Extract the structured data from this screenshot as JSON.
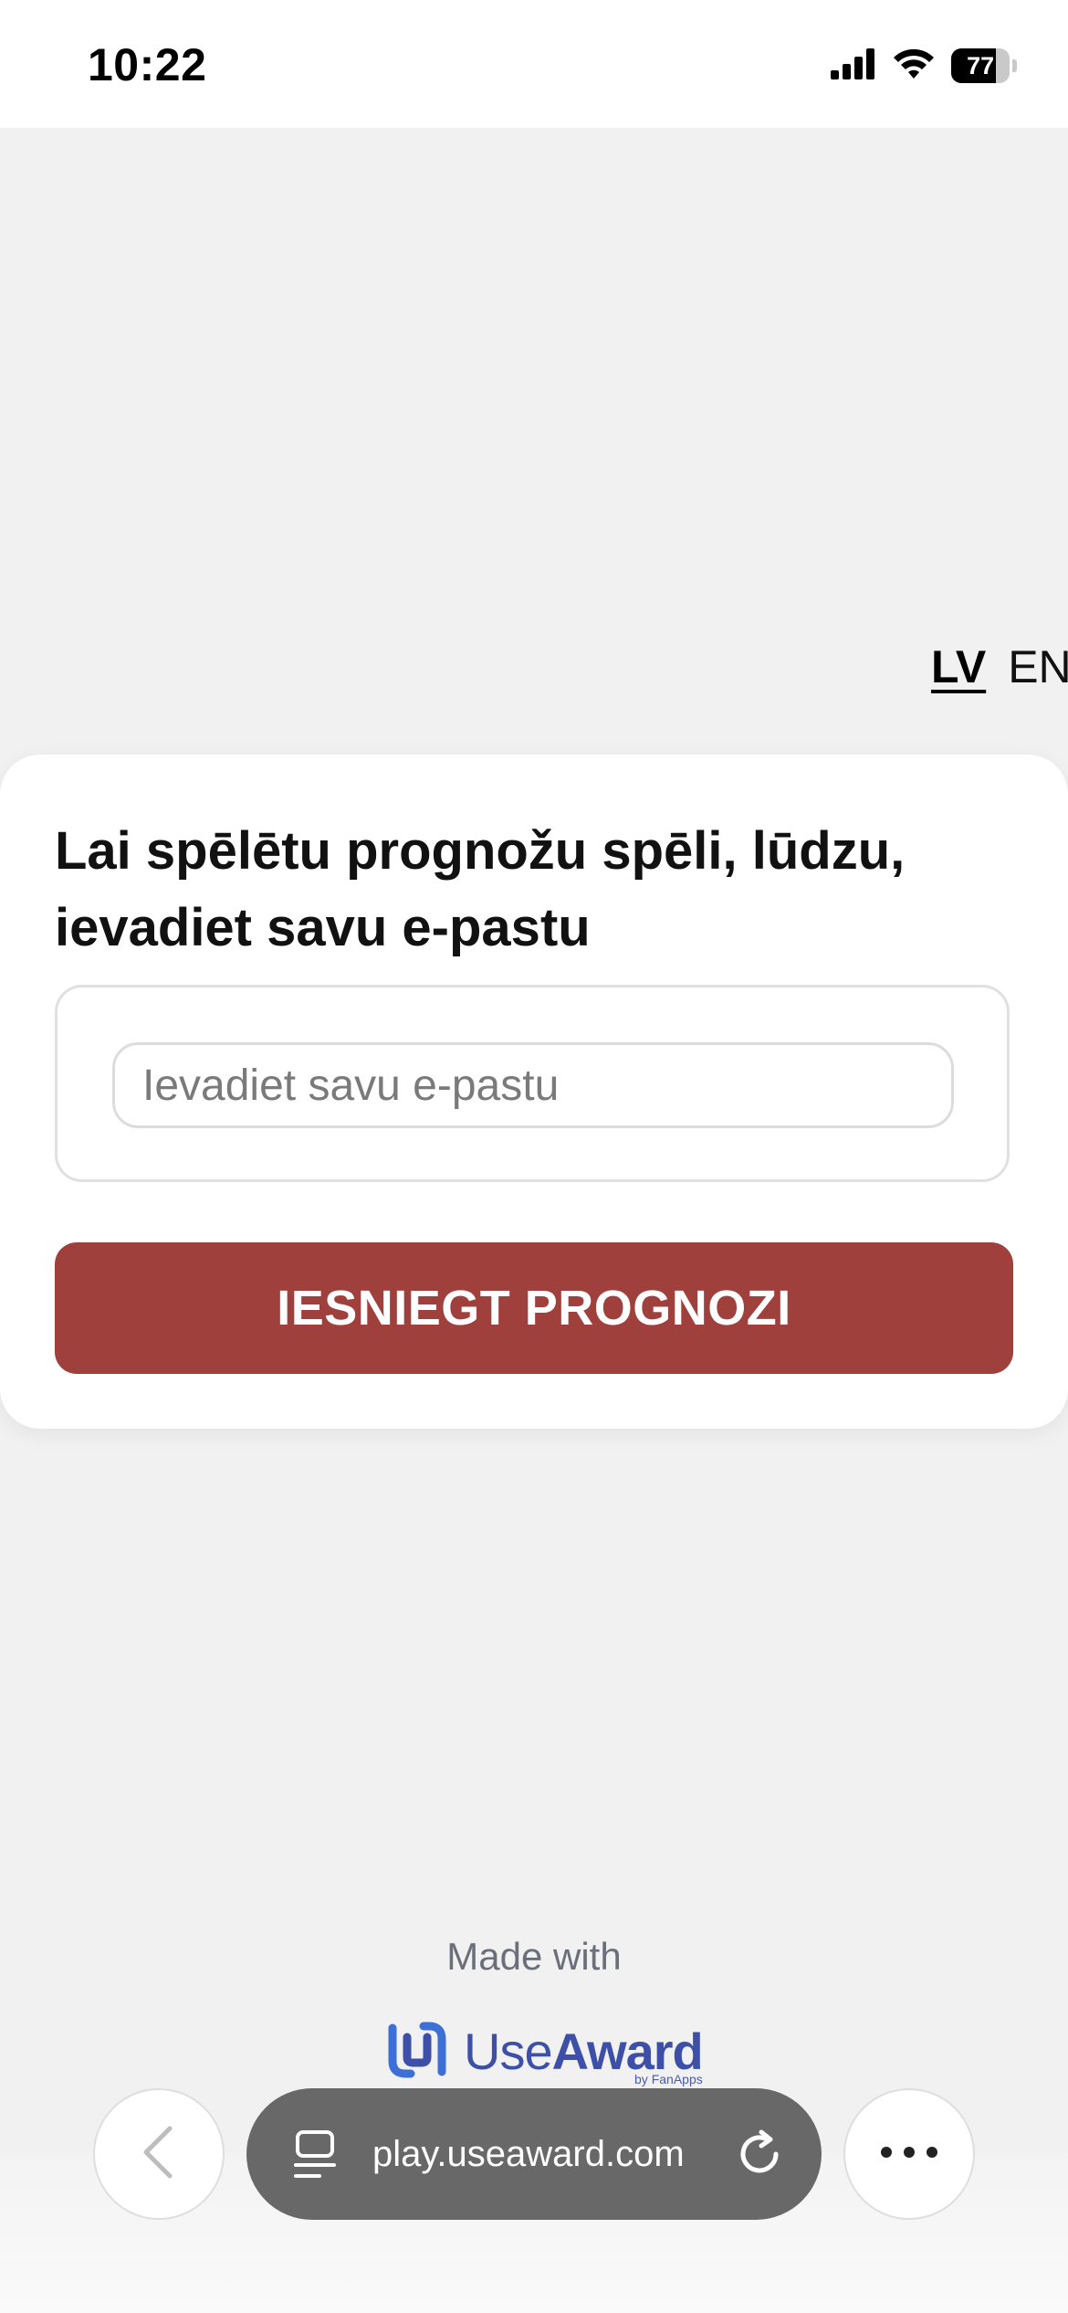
{
  "status_bar": {
    "time": "10:22",
    "battery_percent": "77",
    "battery_level": 0.77
  },
  "language": {
    "active": "LV",
    "other": "EN"
  },
  "form": {
    "title": "Lai spēlētu prognožu spēli, lūdzu, ievadiet savu e-pastu",
    "email_placeholder": "Ievadiet savu e-pastu",
    "email_value": "",
    "submit_label": "IESNIEGT PROGNOZI"
  },
  "footer": {
    "made_with": "Made with",
    "brand_use": "Use",
    "brand_award": "Award",
    "brand_by": "by FanApps"
  },
  "browser": {
    "address": "play.useaward.com",
    "icons": [
      "back-icon",
      "tabs-icon",
      "reload-icon",
      "more-icon"
    ]
  },
  "colors": {
    "accent": "#a0403c",
    "brand": "#3d4fa6",
    "page_background": "#f1f1f1"
  }
}
